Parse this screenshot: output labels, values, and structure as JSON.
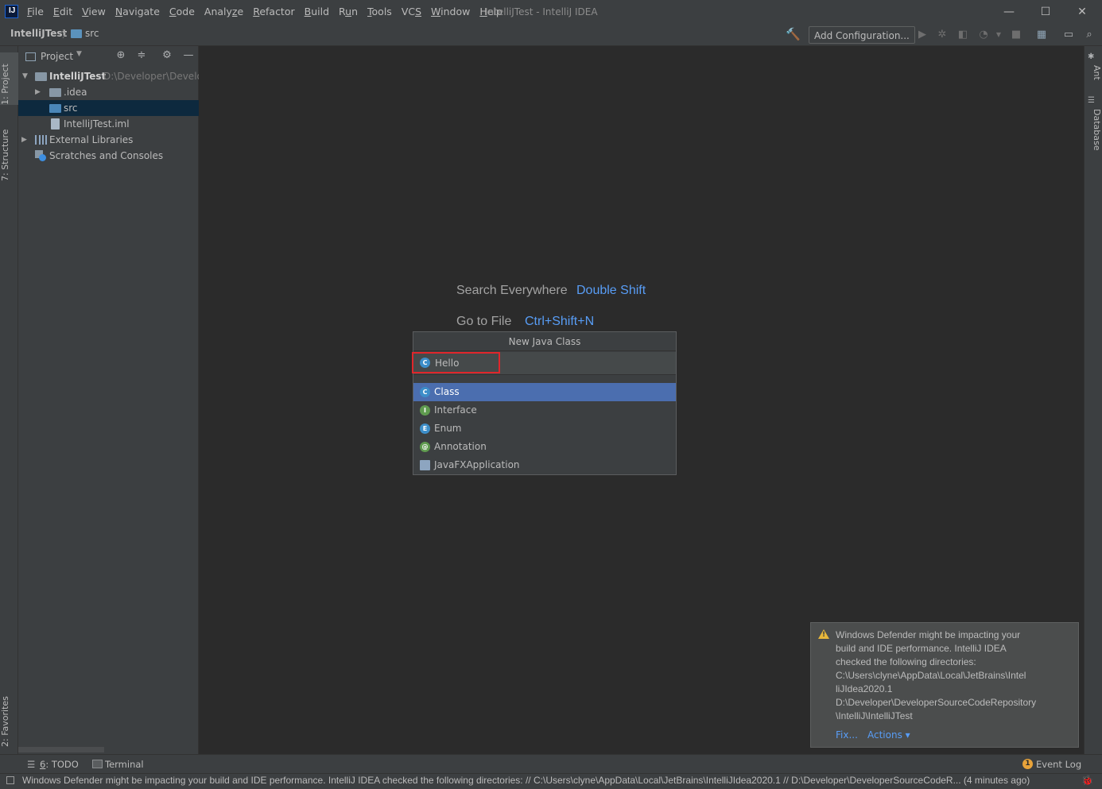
{
  "window": {
    "title": "IntelliJTest - IntelliJ IDEA",
    "logo_letter": "IJ",
    "minimize": "—",
    "maximize": "☐",
    "close": "✕"
  },
  "menu": [
    {
      "prefix": "",
      "mnemonic": "F",
      "rest": "ile"
    },
    {
      "prefix": "",
      "mnemonic": "E",
      "rest": "dit"
    },
    {
      "prefix": "",
      "mnemonic": "V",
      "rest": "iew"
    },
    {
      "prefix": "",
      "mnemonic": "N",
      "rest": "avigate"
    },
    {
      "prefix": "",
      "mnemonic": "C",
      "rest": "ode"
    },
    {
      "prefix": "Analy",
      "mnemonic": "z",
      "rest": "e"
    },
    {
      "prefix": "",
      "mnemonic": "R",
      "rest": "efactor"
    },
    {
      "prefix": "",
      "mnemonic": "B",
      "rest": "uild"
    },
    {
      "prefix": "R",
      "mnemonic": "u",
      "rest": "n"
    },
    {
      "prefix": "",
      "mnemonic": "T",
      "rest": "ools"
    },
    {
      "prefix": "VC",
      "mnemonic": "S",
      "rest": ""
    },
    {
      "prefix": "",
      "mnemonic": "W",
      "rest": "indow"
    },
    {
      "prefix": "",
      "mnemonic": "H",
      "rest": "elp"
    }
  ],
  "breadcrumb": {
    "project": "IntelliJTest",
    "separator": "〉",
    "folder": "src"
  },
  "toolbar": {
    "add_configuration": "Add Configuration..."
  },
  "left_tabs": {
    "project": "1: Project",
    "structure": "7: Structure",
    "favorites": "2: Favorites"
  },
  "right_tabs": {
    "ant": "Ant",
    "database": "Database"
  },
  "project_panel": {
    "title": "Project",
    "tree": {
      "root_name": "IntelliJTest",
      "root_path": "D:\\Developer\\Develo",
      "idea": ".idea",
      "src": "src",
      "iml": "IntelliJTest.iml",
      "external_libraries": "External Libraries",
      "scratches": "Scratches and Consoles"
    }
  },
  "editor_hints": {
    "search_label": "Search Everywhere",
    "search_key": "Double Shift",
    "goto_label": "Go to File",
    "goto_key": "Ctrl+Shift+N"
  },
  "dialog": {
    "title": "New Java Class",
    "name_value": "Hello",
    "kinds": [
      {
        "label": "Class",
        "letter": "C",
        "color": "#3d8ec9"
      },
      {
        "label": "Interface",
        "letter": "I",
        "color": "#5f9b4f"
      },
      {
        "label": "Enum",
        "letter": "E",
        "color": "#3d8ec9"
      },
      {
        "label": "Annotation",
        "letter": "@",
        "color": "#5f9b4f"
      },
      {
        "label": "JavaFXApplication",
        "letter": "",
        "color": "#8da5c0"
      }
    ],
    "selected_kind": "Class"
  },
  "notification": {
    "lines": [
      "Windows Defender might be impacting your",
      "build and IDE performance. IntelliJ IDEA",
      "checked the following directories:",
      "C:\\Users\\clyne\\AppData\\Local\\JetBrains\\Intel",
      "liJIdea2020.1",
      "D:\\Developer\\DeveloperSourceCodeRepository",
      "\\IntelliJ\\IntelliJTest"
    ],
    "fix": "Fix...",
    "actions": "Actions ▾"
  },
  "bottom_tabs": {
    "todo_num": "6",
    "todo": ": TODO",
    "terminal": "Terminal",
    "event_log": "Event Log",
    "event_log_count": "1"
  },
  "status": {
    "message": "Windows Defender might be impacting your build and IDE performance. IntelliJ IDEA checked the following directories: // C:\\Users\\clyne\\AppData\\Local\\JetBrains\\IntelliJIdea2020.1 // D:\\Developer\\DeveloperSourceCodeR... (4 minutes ago)"
  }
}
